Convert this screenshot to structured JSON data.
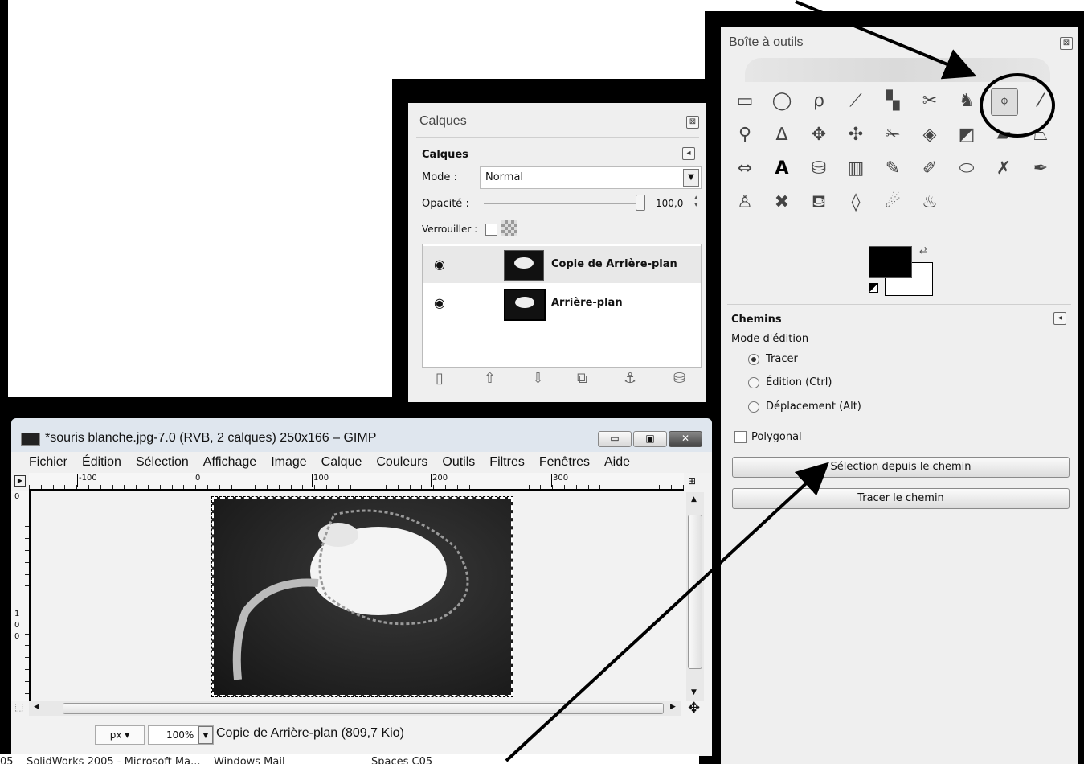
{
  "toolbox": {
    "title": "Boîte à outils",
    "close": "⊠",
    "tools": [
      {
        "name": "rect-select-icon",
        "glyph": "▭"
      },
      {
        "name": "ellipse-select-icon",
        "glyph": "◯"
      },
      {
        "name": "free-select-icon",
        "glyph": "ρ"
      },
      {
        "name": "fuzzy-select-icon",
        "glyph": "⟋"
      },
      {
        "name": "color-select-icon",
        "glyph": "▚"
      },
      {
        "name": "scissors-icon",
        "glyph": "✂"
      },
      {
        "name": "foreground-select-icon",
        "glyph": "♞"
      },
      {
        "name": "paths-icon",
        "glyph": "⌖"
      },
      {
        "name": "color-picker-icon",
        "glyph": "⁄"
      },
      {
        "name": "zoom-icon",
        "glyph": "⚲"
      },
      {
        "name": "measure-icon",
        "glyph": "∆"
      },
      {
        "name": "move-icon",
        "glyph": "✥"
      },
      {
        "name": "align-icon",
        "glyph": "✣"
      },
      {
        "name": "crop-icon",
        "glyph": "✁"
      },
      {
        "name": "rotate-icon",
        "glyph": "◈"
      },
      {
        "name": "scale-icon",
        "glyph": "◩"
      },
      {
        "name": "shear-icon",
        "glyph": "▰"
      },
      {
        "name": "perspective-icon",
        "glyph": "⏢"
      },
      {
        "name": "flip-icon",
        "glyph": "⇔"
      },
      {
        "name": "text-icon",
        "glyph": "A"
      },
      {
        "name": "bucket-fill-icon",
        "glyph": "⛁"
      },
      {
        "name": "blend-icon",
        "glyph": "▥"
      },
      {
        "name": "pencil-icon",
        "glyph": "✎"
      },
      {
        "name": "paintbrush-icon",
        "glyph": "✐"
      },
      {
        "name": "eraser-icon",
        "glyph": "⬭"
      },
      {
        "name": "airbrush-icon",
        "glyph": "✗"
      },
      {
        "name": "ink-icon",
        "glyph": "✒"
      },
      {
        "name": "clone-icon",
        "glyph": "♙"
      },
      {
        "name": "heal-icon",
        "glyph": "✖"
      },
      {
        "name": "perspective-clone-icon",
        "glyph": "⛾"
      },
      {
        "name": "blur-icon",
        "glyph": "◊"
      },
      {
        "name": "smudge-icon",
        "glyph": "☄"
      },
      {
        "name": "dodge-burn-icon",
        "glyph": "♨"
      }
    ],
    "fg_color": "#000000",
    "bg_color": "#ffffff",
    "options": {
      "title": "Chemins",
      "mode_label": "Mode d'édition",
      "modes": [
        {
          "label": "Tracer",
          "selected": true
        },
        {
          "label": "Édition (Ctrl)",
          "selected": false
        },
        {
          "label": "Déplacement (Alt)",
          "selected": false
        }
      ],
      "polygonal": "Polygonal",
      "btn_selection": "Sélection depuis le chemin",
      "btn_trace": "Tracer le chemin"
    }
  },
  "layers": {
    "window_title": "Calques",
    "section_title": "Calques",
    "mode_label": "Mode :",
    "mode_value": "Normal",
    "opacity_label": "Opacité :",
    "opacity_value": "100,0",
    "lock_label": "Verrouiller :",
    "items": [
      {
        "name": "Copie de Arrière-plan"
      },
      {
        "name": "Arrière-plan"
      }
    ]
  },
  "image_window": {
    "title": "*souris blanche.jpg-7.0 (RVB, 2 calques) 250x166 – GIMP",
    "menu": [
      "Fichier",
      "Édition",
      "Sélection",
      "Affichage",
      "Image",
      "Calque",
      "Couleurs",
      "Outils",
      "Filtres",
      "Fenêtres",
      "Aide"
    ],
    "ruler_labels": [
      "-100",
      "0",
      "100",
      "200",
      "300"
    ],
    "vruler_labels": [
      "0",
      "1",
      "0",
      "0"
    ],
    "unit": "px",
    "zoom": "100%",
    "status": "Copie de Arrière-plan (809,7 Kio)"
  },
  "taskbar_text": "05    SolidWorks 2005 - Microsoft Ma...    Windows Mail                          Spaces C05"
}
